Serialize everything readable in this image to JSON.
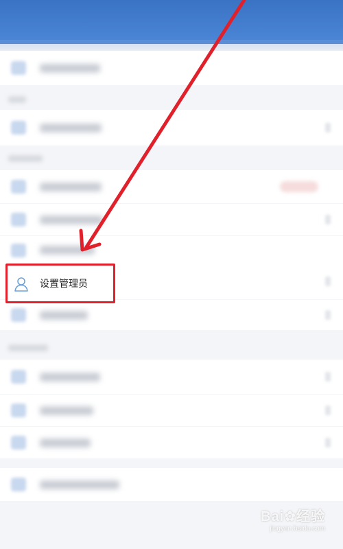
{
  "highlighted_item": {
    "label": "设置管理员",
    "icon": "user-outline-icon"
  },
  "annotation": {
    "color": "#e0202a",
    "type": "arrow-pointer"
  },
  "watermark": {
    "brand": "Bai",
    "suffix": "经验",
    "sub": "jingyan.baidu.com"
  },
  "colors": {
    "header": "#3a73c4",
    "background": "#f4f5f8",
    "icon_blue": "#6aa0d8"
  }
}
